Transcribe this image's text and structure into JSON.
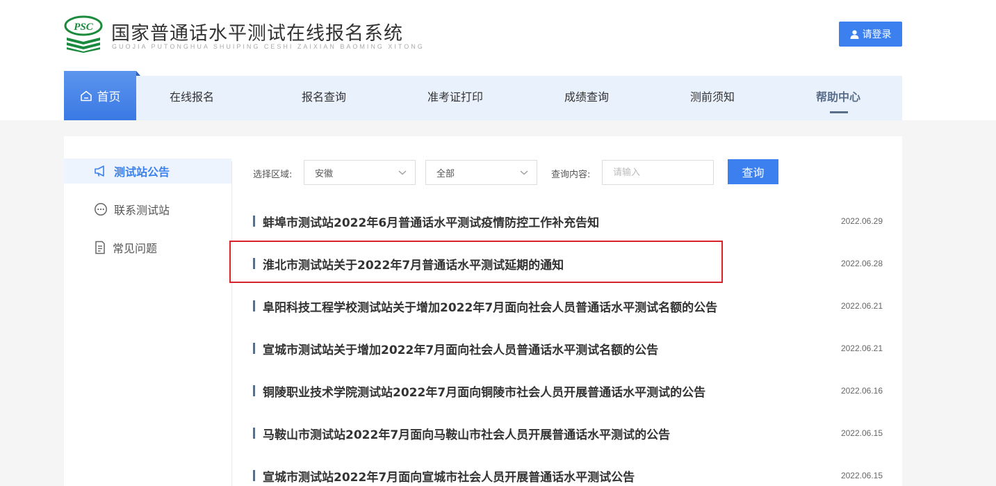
{
  "header": {
    "logo_text": "PSC",
    "title": "国家普通话水平测试在线报名系统",
    "subtitle": "GUOJIA PUTONGHUA SHUIPING CESHI ZAIXIAN BAOMING XITONG",
    "login_label": "请登录"
  },
  "nav": {
    "home": "首页",
    "items": [
      "在线报名",
      "报名查询",
      "准考证打印",
      "成绩查询",
      "测前须知",
      "帮助中心"
    ],
    "active": "帮助中心"
  },
  "sidebar": {
    "items": [
      {
        "label": "测试站公告",
        "icon": "megaphone-icon",
        "active": true
      },
      {
        "label": "联系测试站",
        "icon": "chat-icon",
        "active": false
      },
      {
        "label": "常见问题",
        "icon": "document-icon",
        "active": false
      }
    ]
  },
  "filter": {
    "region_label": "选择区域:",
    "region_value": "安徽",
    "category_value": "全部",
    "query_label": "查询内容:",
    "query_placeholder": "请输入",
    "query_button": "查询"
  },
  "notices": [
    {
      "title": "蚌埠市测试站2022年6月普通话水平测试疫情防控工作补充告知",
      "date": "2022.06.29"
    },
    {
      "title": "淮北市测试站关于2022年7月普通话水平测试延期的通知",
      "date": "2022.06.28"
    },
    {
      "title": "阜阳科技工程学校测试站关于增加2022年7月面向社会人员普通话水平测试名额的公告",
      "date": "2022.06.21"
    },
    {
      "title": "宣城市测试站关于增加2022年7月面向社会人员普通话水平测试名额的公告",
      "date": "2022.06.21"
    },
    {
      "title": "铜陵职业技术学院测试站2022年7月面向铜陵市社会人员开展普通话水平测试的公告",
      "date": "2022.06.16"
    },
    {
      "title": "马鞍山市测试站2022年7月面向马鞍山市社会人员开展普通话水平测试的公告",
      "date": "2022.06.15"
    },
    {
      "title": "宣城市测试站2022年7月面向宣城市社会人员开展普通话水平测试公告",
      "date": "2022.06.15"
    }
  ],
  "colors": {
    "primary": "#3b80ee",
    "nav_bg": "#e9f1fc",
    "accent_bar": "#596e88",
    "logo_green": "#1a8a3c",
    "highlight": "#d9232b"
  }
}
